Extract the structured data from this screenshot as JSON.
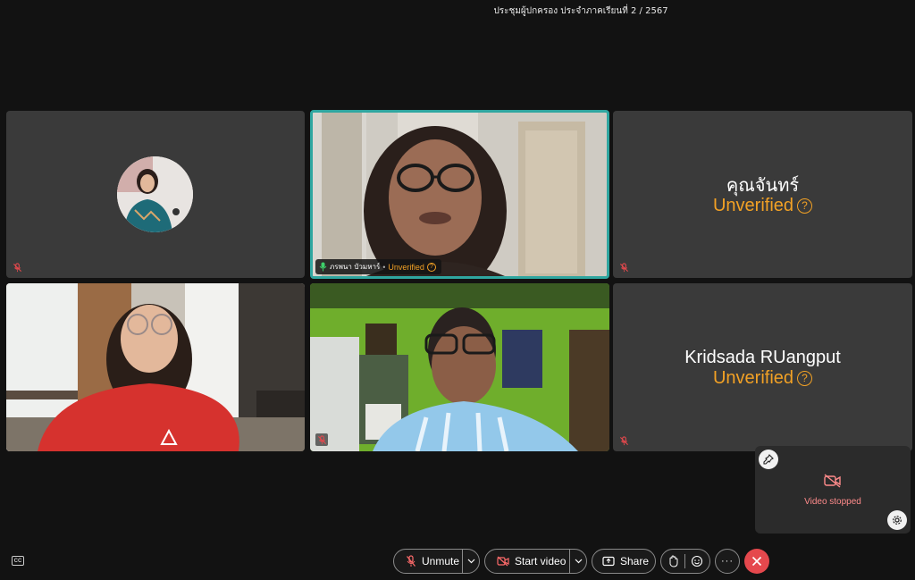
{
  "meeting": {
    "title": "ประชุมผู้ปกครอง ประจำภาคเรียนที่ 2 / 2567"
  },
  "participants": {
    "p1": {
      "muted": true
    },
    "p2": {
      "name": "ภรพนา บัวมหาร์",
      "separator": "•",
      "status": "Unverified",
      "active_speaker": true
    },
    "p3": {
      "name": "คุณจันทร์",
      "status": "Unverified",
      "muted": true
    },
    "p4": {
      "muted": false
    },
    "p5": {
      "muted": true
    },
    "p6": {
      "name": "Kridsada RUangput",
      "status": "Unverified",
      "muted": true
    }
  },
  "self_view": {
    "status_text": "Video stopped"
  },
  "toolbar": {
    "unmute_label": "Unmute",
    "start_video_label": "Start video",
    "share_label": "Share",
    "more_label": "···"
  },
  "captions": {
    "label": "CC"
  },
  "colors": {
    "unverified": "#f2a125",
    "active_border": "#2fa6a0",
    "leave": "#e5484d",
    "video_stopped": "#ff8b8b"
  },
  "icons": [
    "mic-muted-icon",
    "mic-on-icon",
    "help-icon",
    "pin-icon",
    "gear-icon",
    "video-off-icon",
    "share-screen-icon",
    "raise-hand-icon",
    "emoji-icon",
    "more-icon",
    "close-icon",
    "chevron-down-icon",
    "captions-icon"
  ]
}
